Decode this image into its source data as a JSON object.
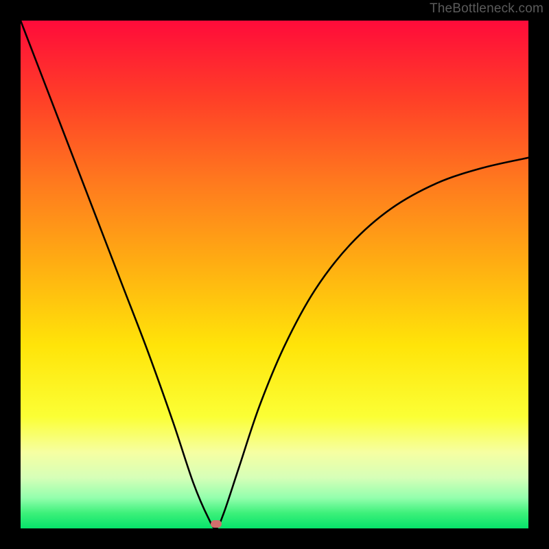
{
  "watermark": "TheBottleneck.com",
  "chart_data": {
    "type": "line",
    "title": "",
    "xlabel": "",
    "ylabel": "",
    "xlim": [
      0,
      100
    ],
    "ylim": [
      0,
      100
    ],
    "grid": false,
    "legend": false,
    "background_gradient": {
      "top_color": "#ff0b3a",
      "bottom_color": "#06e36a",
      "description": "vertical gradient red→orange→yellow→green"
    },
    "series": [
      {
        "name": "bottleneck-curve",
        "color": "#000000",
        "x": [
          0,
          5,
          10,
          15,
          20,
          25,
          30,
          34,
          37,
          38.5,
          40,
          43,
          47,
          52,
          58,
          65,
          73,
          82,
          91,
          100
        ],
        "y": [
          100,
          87,
          74,
          61,
          48,
          35,
          21,
          9,
          2,
          0,
          3,
          12,
          24,
          36,
          47,
          56,
          63,
          68,
          71,
          73
        ]
      }
    ],
    "marker": {
      "name": "optimal-point",
      "x": 38.5,
      "y": 0.8,
      "color": "#cf6f6c",
      "shape": "rounded-rect"
    }
  }
}
